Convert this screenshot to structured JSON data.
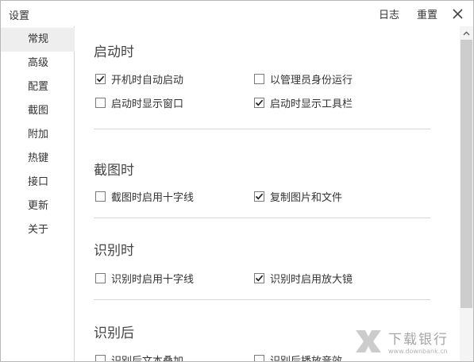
{
  "window": {
    "title": "设置",
    "log_label": "日志",
    "reset_label": "重置",
    "close_icon": "close-icon"
  },
  "sidebar": {
    "items": [
      {
        "label": "常规",
        "active": true
      },
      {
        "label": "高级",
        "active": false
      },
      {
        "label": "配置",
        "active": false
      },
      {
        "label": "截图",
        "active": false
      },
      {
        "label": "附加",
        "active": false
      },
      {
        "label": "热键",
        "active": false
      },
      {
        "label": "接口",
        "active": false
      },
      {
        "label": "更新",
        "active": false
      },
      {
        "label": "关于",
        "active": false
      }
    ]
  },
  "sections": {
    "startup": {
      "title": "启动时",
      "options": [
        {
          "label": "开机时自动启动",
          "checked": true
        },
        {
          "label": "以管理员身份运行",
          "checked": false
        },
        {
          "label": "启动时显示窗口",
          "checked": false
        },
        {
          "label": "启动时显示工具栏",
          "checked": true
        }
      ]
    },
    "screenshot": {
      "title": "截图时",
      "options": [
        {
          "label": "截图时启用十字线",
          "checked": false
        },
        {
          "label": "复制图片和文件",
          "checked": true
        }
      ]
    },
    "recognizing": {
      "title": "识别时",
      "options": [
        {
          "label": "识别时启用十字线",
          "checked": false
        },
        {
          "label": "识别时启用放大镜",
          "checked": true
        }
      ]
    },
    "after": {
      "title": "识别后",
      "options": [
        {
          "label": "识别后文本叠加",
          "checked": false
        },
        {
          "label": "识别后播放音效",
          "checked": false
        }
      ]
    }
  },
  "watermark": {
    "name": "下载银行",
    "url": "www.downbank.cn"
  }
}
